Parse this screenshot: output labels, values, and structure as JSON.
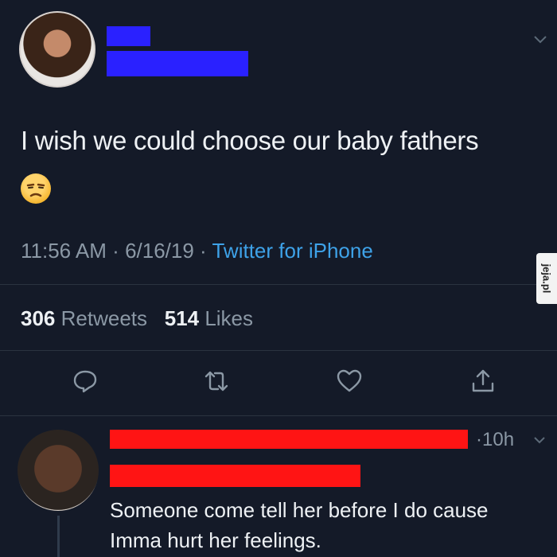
{
  "tweet": {
    "text": "I wish we could choose our baby fathers",
    "emoji": "unamused-face",
    "time": "11:56 AM",
    "date": "6/16/19",
    "source": "Twitter for iPhone",
    "retweets_count": "306",
    "retweets_label": "Retweets",
    "likes_count": "514",
    "likes_label": "Likes"
  },
  "reply": {
    "time": "10h",
    "text_line1": "Someone come tell her before I do cause",
    "text_line2": "Imma hurt her feelings."
  },
  "watermark": "jeja.pl",
  "colors": {
    "background": "#141a28",
    "text": "#eef1f4",
    "muted": "#8b98a5",
    "link": "#3ea2e8",
    "redact_blue": "#2a21ff",
    "redact_red": "#ff1414"
  },
  "icons": [
    "chevron-down-icon",
    "reply-icon",
    "retweet-icon",
    "like-icon",
    "share-icon"
  ]
}
